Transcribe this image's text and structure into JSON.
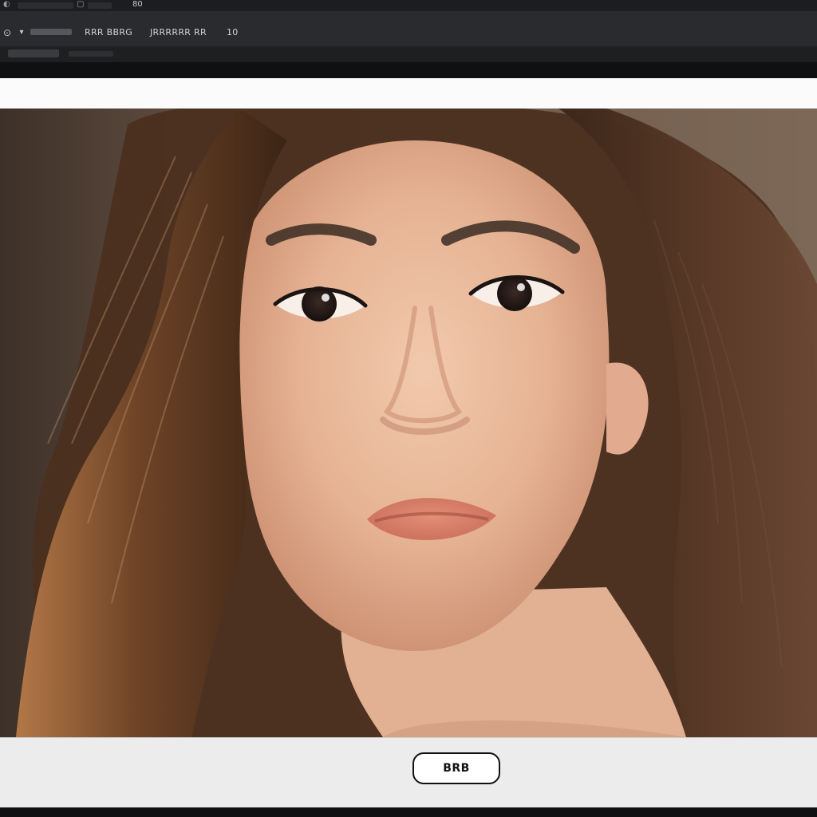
{
  "topbar": {
    "left_icon": "window-icon",
    "mid_icon": "square-icon",
    "label": "80"
  },
  "toolbar": {
    "tool_icon": "eyedropper-icon",
    "menu_1": "RRR BBRG",
    "menu_2": "JRRRRRR RR",
    "value": "10"
  },
  "colors": {
    "app_bg": "#111214",
    "toolbar_bg": "#2a2b2e",
    "panel_bg": "#f3f3f3",
    "button_border": "#111111"
  },
  "dialog": {
    "primary_button": "BRB"
  }
}
